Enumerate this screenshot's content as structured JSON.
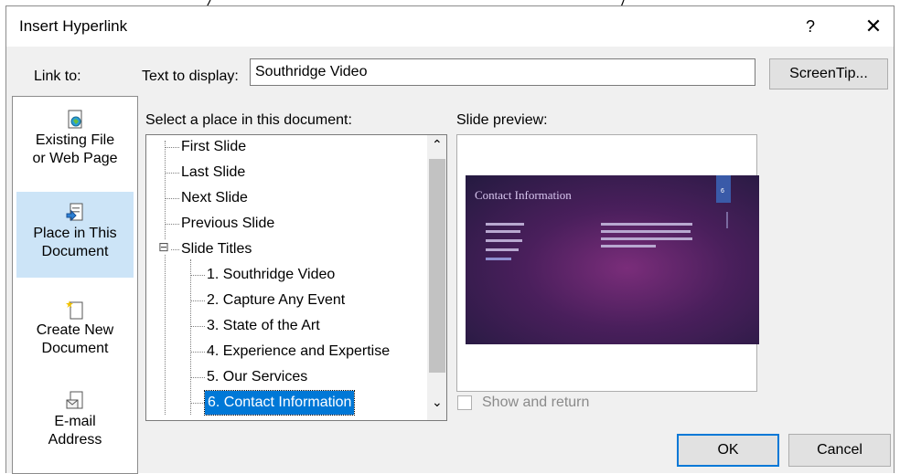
{
  "dialog": {
    "title": "Insert Hyperlink",
    "help_label": "?",
    "close_label": "✕"
  },
  "link_to": {
    "label": "Link to:",
    "items": [
      {
        "label_a": "Existing File",
        "label_b": "or Web Page",
        "icon": "web-file-icon",
        "selected": false
      },
      {
        "label_a": "Place in This",
        "label_b": "Document",
        "icon": "place-in-document-icon",
        "selected": true
      },
      {
        "label_a": "Create New",
        "label_b": "Document",
        "icon": "new-document-icon",
        "selected": false
      },
      {
        "label_a": "E-mail",
        "label_b": "Address",
        "icon": "email-icon",
        "selected": false
      }
    ]
  },
  "text_to_display": {
    "label": "Text to display:",
    "value": "Southridge Video"
  },
  "screentip_label": "ScreenTip...",
  "place": {
    "label": "Select a place in this document:",
    "nodes": [
      {
        "label": "First Slide"
      },
      {
        "label": "Last Slide"
      },
      {
        "label": "Next Slide"
      },
      {
        "label": "Previous Slide"
      },
      {
        "label": "Slide Titles",
        "expander": "⊟"
      },
      {
        "label": "1. Southridge Video"
      },
      {
        "label": "2. Capture Any Event"
      },
      {
        "label": "3. State of the Art"
      },
      {
        "label": "4. Experience and Expertise"
      },
      {
        "label": "5. Our Services"
      },
      {
        "label": "6. Contact Information",
        "selected": true
      }
    ],
    "scroll_up": "⌃",
    "scroll_down": "⌄"
  },
  "preview": {
    "label": "Slide preview:",
    "slide_title": "Contact Information",
    "slide_number": "6"
  },
  "show_and_return": {
    "label": "Show and return",
    "checked": false
  },
  "buttons": {
    "ok": "OK",
    "cancel": "Cancel"
  },
  "colors": {
    "selection": "#0078d7",
    "linkbar_selected": "#cce4f7",
    "dialog_bg": "#f0f0f0"
  }
}
